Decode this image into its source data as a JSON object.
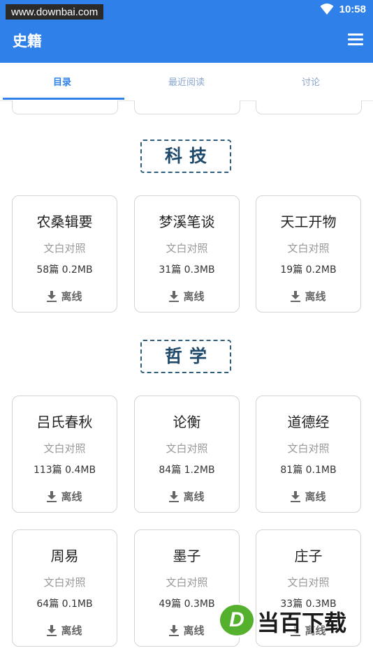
{
  "status_bar": {
    "watermark": "www.downbai.com",
    "time": "10:58"
  },
  "app_bar": {
    "title": "史籍"
  },
  "tabs": [
    {
      "label": "目录",
      "active": true
    },
    {
      "label": "最近阅读",
      "active": false
    },
    {
      "label": "讨论",
      "active": false
    }
  ],
  "sections": [
    {
      "name": "科技",
      "books": [
        {
          "title": "农桑辑要",
          "subtitle": "文白对照",
          "meta": "58篇 0.2MB",
          "action": "离线"
        },
        {
          "title": "梦溪笔谈",
          "subtitle": "文白对照",
          "meta": "31篇 0.3MB",
          "action": "离线"
        },
        {
          "title": "天工开物",
          "subtitle": "文白对照",
          "meta": "19篇 0.2MB",
          "action": "离线"
        }
      ]
    },
    {
      "name": "哲学",
      "books": [
        {
          "title": "吕氏春秋",
          "subtitle": "文白对照",
          "meta": "113篇 0.4MB",
          "action": "离线"
        },
        {
          "title": "论衡",
          "subtitle": "文白对照",
          "meta": "84篇 1.2MB",
          "action": "离线"
        },
        {
          "title": "道德经",
          "subtitle": "文白对照",
          "meta": "81篇 0.1MB",
          "action": "离线"
        },
        {
          "title": "周易",
          "subtitle": "文白对照",
          "meta": "64篇 0.1MB",
          "action": "离线"
        },
        {
          "title": "墨子",
          "subtitle": "文白对照",
          "meta": "49篇 0.3MB",
          "action": "离线"
        },
        {
          "title": "庄子",
          "subtitle": "文白对照",
          "meta": "33篇 0.3MB",
          "action": "离线"
        }
      ]
    }
  ],
  "logo": {
    "letter": "D",
    "text": "当百下载"
  },
  "colors": {
    "primary": "#2f80e8",
    "section_border": "#2f5d7c"
  }
}
